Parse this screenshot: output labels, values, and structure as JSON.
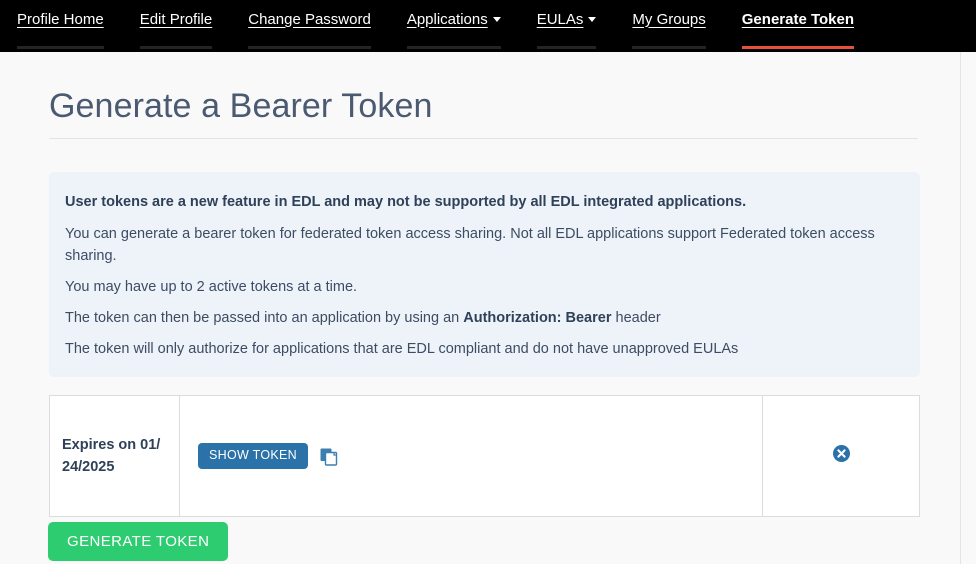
{
  "nav": {
    "items": [
      {
        "label": "Profile Home",
        "has_caret": false,
        "active": false
      },
      {
        "label": "Edit Profile",
        "has_caret": false,
        "active": false
      },
      {
        "label": "Change Password",
        "has_caret": false,
        "active": false
      },
      {
        "label": "Applications",
        "has_caret": true,
        "active": false
      },
      {
        "label": "EULAs",
        "has_caret": true,
        "active": false
      },
      {
        "label": "My Groups",
        "has_caret": false,
        "active": false
      },
      {
        "label": "Generate Token",
        "has_caret": false,
        "active": true
      }
    ]
  },
  "page": {
    "title": "Generate a Bearer Token"
  },
  "info_panel": {
    "lead": "User tokens are a new feature in EDL and may not be supported by all EDL integrated applications.",
    "para1": "You can generate a bearer token for federated token access sharing. Not all EDL applications support Federated token access sharing.",
    "para2": "You may have up to 2 active tokens at a time.",
    "para3_prefix": "The token can then be passed into an application by using an ",
    "para3_bold": "Authorization: Bearer",
    "para3_suffix": " header",
    "para4": "The token will only authorize for applications that are EDL compliant and do not have unapproved EULAs"
  },
  "token_table": {
    "rows": [
      {
        "expires": "Expires on 01/24/2025",
        "show_token_label": "SHOW TOKEN",
        "copy_icon": "copy-icon",
        "delete_icon": "delete-circle-icon"
      }
    ]
  },
  "actions": {
    "generate_label": "GENERATE TOKEN"
  },
  "colors": {
    "navbar_bg": "#000000",
    "active_underline": "#e8503a",
    "inactive_underline": "#222426",
    "page_bg": "#f9f9fa",
    "info_panel_bg": "#eef3f9",
    "title_text": "#4b5a70",
    "body_text": "#3d4c63",
    "blue_button": "#2a72a8",
    "green_button": "#2ecc71",
    "table_border": "#dcdcdc"
  }
}
